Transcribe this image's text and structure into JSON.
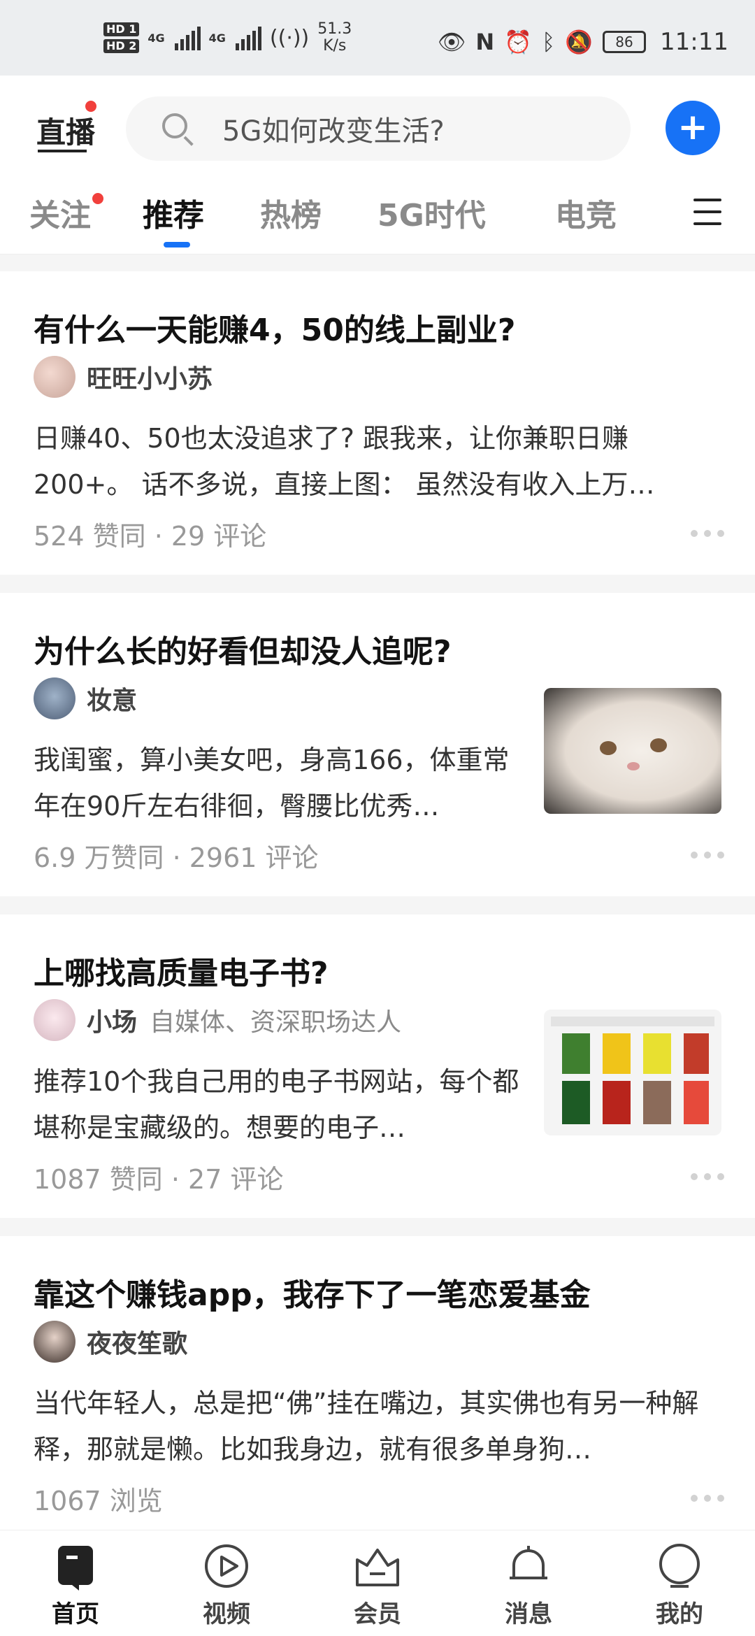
{
  "status_bar": {
    "hd1": "HD 1",
    "hd2": "HD 2",
    "net1": "4G",
    "net2": "4G",
    "speed_value": "51.3",
    "speed_unit": "K/s",
    "battery": "86",
    "time": "11:11"
  },
  "header": {
    "live_label": "直播",
    "search_placeholder": "5G如何改变生活?",
    "add_icon": "plus-icon"
  },
  "tabs": [
    {
      "label": "关注",
      "has_dot": true
    },
    {
      "label": "推荐",
      "active": true
    },
    {
      "label": "热榜"
    },
    {
      "label": "5G时代"
    },
    {
      "label": "电竞"
    }
  ],
  "feed": [
    {
      "title": "有什么一天能赚4，50的线上副业?",
      "author": "旺旺小小苏",
      "author_tag": "",
      "excerpt": "日赚40、50也太没追求了? 跟我来，让你兼职日赚200+。 话不多说，直接上图： 虽然没有收入上万…",
      "meta": "524 赞同 · 29 评论",
      "has_thumb": false
    },
    {
      "title": "为什么长的好看但却没人追呢?",
      "author": "妆意",
      "author_tag": "",
      "excerpt": "我闺蜜，算小美女吧，身高166，体重常年在90斤左右徘徊，臀腰比优秀…",
      "meta": "6.9 万赞同 · 2961 评论",
      "has_thumb": true
    },
    {
      "title": "上哪找高质量电子书?",
      "author": "小场",
      "author_tag": "自媒体、资深职场达人",
      "excerpt": "推荐10个我自己用的电子书网站，每个都堪称是宝藏级的。想要的电子…",
      "meta": "1087 赞同 · 27 评论",
      "has_thumb": true
    },
    {
      "title": "靠这个赚钱app，我存下了一笔恋爱基金",
      "author": "夜夜笙歌",
      "author_tag": "",
      "excerpt": "当代年轻人，总是把“佛”挂在嘴边，其实佛也有另一种解释，那就是懒。比如我身边，就有很多单身狗…",
      "meta": "1067 浏览",
      "has_thumb": false
    }
  ],
  "bottom_nav": [
    {
      "label": "首页",
      "icon": "home-icon",
      "active": true
    },
    {
      "label": "视频",
      "icon": "video-icon"
    },
    {
      "label": "会员",
      "icon": "vip-crown-icon"
    },
    {
      "label": "消息",
      "icon": "bell-icon"
    },
    {
      "label": "我的",
      "icon": "profile-icon"
    }
  ],
  "colors": {
    "accent": "#1772f6",
    "badge": "#f1403c"
  }
}
